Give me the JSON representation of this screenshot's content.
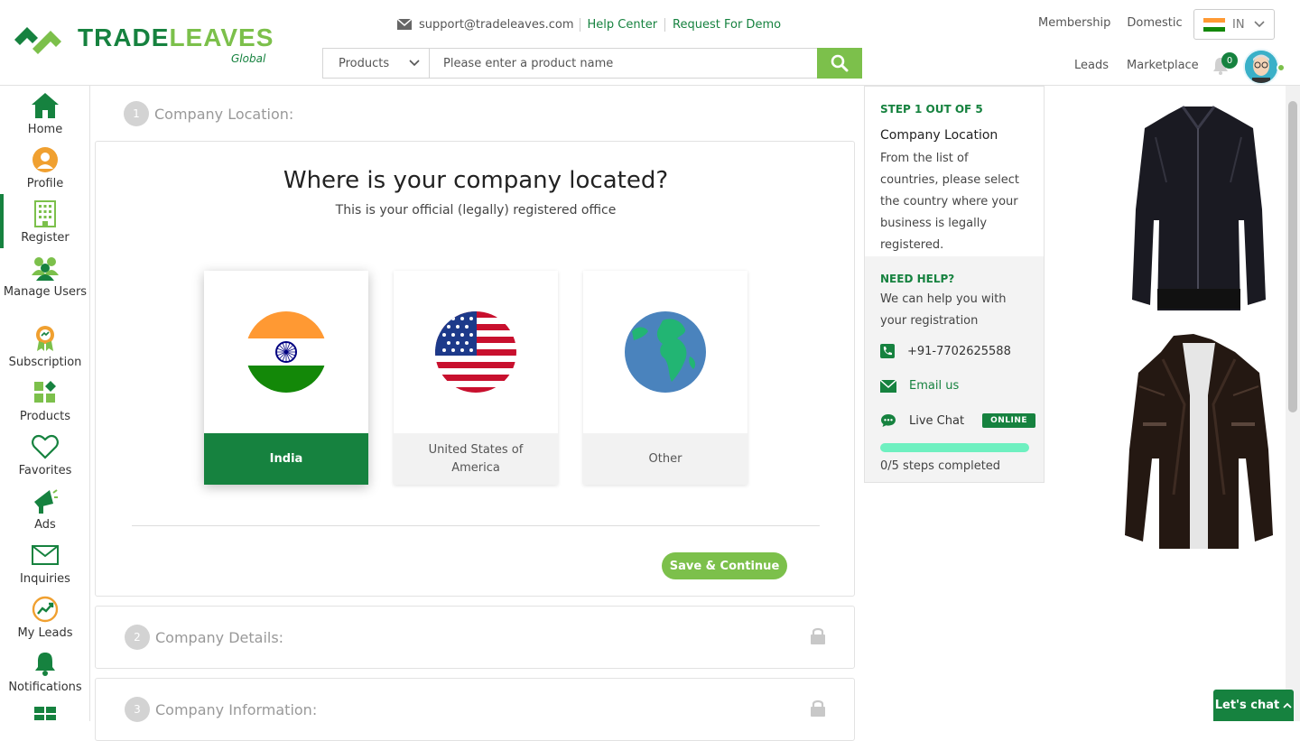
{
  "header": {
    "logo_trade": "TRADE",
    "logo_leaves": "LEAVES",
    "logo_sub": "Global",
    "support_email": "support@tradeleaves.com",
    "help_center": "Help Center",
    "request_demo": "Request For Demo",
    "search_category": "Products",
    "search_placeholder": "Please enter a product name",
    "membership": "Membership",
    "domestic": "Domestic",
    "country_code": "IN",
    "leads": "Leads",
    "marketplace": "Marketplace",
    "notification_count": "0"
  },
  "sidebar": {
    "items": [
      {
        "label": "Home",
        "icon": "home-icon"
      },
      {
        "label": "Profile",
        "icon": "profile-icon"
      },
      {
        "label": "Register",
        "icon": "building-icon"
      },
      {
        "label": "Manage Users",
        "icon": "users-icon"
      },
      {
        "label": "Subscription",
        "icon": "badge-icon"
      },
      {
        "label": "Products",
        "icon": "products-icon"
      },
      {
        "label": "Favorites",
        "icon": "heart-icon"
      },
      {
        "label": "Ads",
        "icon": "megaphone-icon"
      },
      {
        "label": "Inquiries",
        "icon": "envelope-icon"
      },
      {
        "label": "My Leads",
        "icon": "leads-icon"
      },
      {
        "label": "Notifications",
        "icon": "bell-icon"
      }
    ],
    "active": "Register"
  },
  "steps": [
    {
      "num": "1",
      "label": "Company Location:"
    },
    {
      "num": "2",
      "label": "Company Details:"
    },
    {
      "num": "3",
      "label": "Company Information:"
    }
  ],
  "location": {
    "question": "Where is your company located?",
    "subtitle": "This is your official (legally) registered office",
    "options": [
      {
        "label": "India",
        "selected": true
      },
      {
        "label": "United States of America",
        "selected": false
      },
      {
        "label": "Other",
        "selected": false
      }
    ],
    "save_label": "Save & Continue"
  },
  "help": {
    "step": "STEP 1 OUT OF 5",
    "title": "Company Location",
    "description": "From the list of countries, please select the country where your business is legally registered.",
    "need_help": "NEED HELP?",
    "help_text": "We can help you with your registration",
    "phone": "+91-7702625588",
    "email": "Email us",
    "live_chat": "Live Chat",
    "online": "ONLINE",
    "progress_text": "0/5 steps completed",
    "steps_completed": 0,
    "steps_total": 5
  },
  "chat": {
    "label": "Let's chat"
  },
  "colors": {
    "brand_green": "#16823f",
    "accent_green": "#7cc04b",
    "progress_teal": "#6ef0c0"
  }
}
